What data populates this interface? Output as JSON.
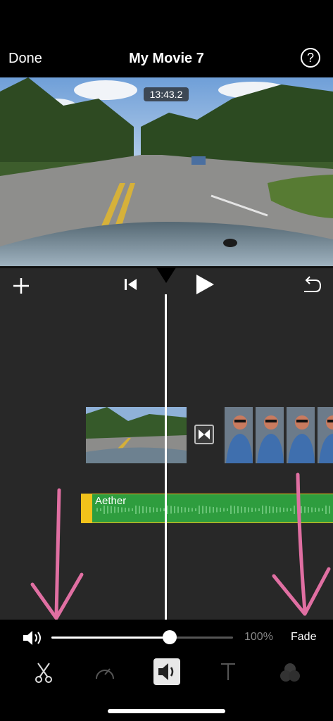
{
  "header": {
    "done_label": "Done",
    "title": "My Movie 7",
    "help_label": "?"
  },
  "preview": {
    "timestamp": "13:43.2"
  },
  "toolbar": {
    "add_icon": "plus-icon",
    "rewind_icon": "skip-back-icon",
    "play_icon": "play-icon",
    "undo_icon": "undo-icon"
  },
  "timeline": {
    "audio_clip_name": "Aether"
  },
  "volume": {
    "percent_label": "100%",
    "fade_label": "Fade",
    "level": 0.65
  },
  "tabs": [
    {
      "icon": "scissors-icon",
      "selected": false
    },
    {
      "icon": "speed-icon",
      "selected": false
    },
    {
      "icon": "volume-icon",
      "selected": true
    },
    {
      "icon": "text-icon",
      "selected": false
    },
    {
      "icon": "filters-icon",
      "selected": false
    }
  ],
  "colors": {
    "audio_clip": "#2e9d3e",
    "audio_border": "#f1c21b",
    "annotation_arrow": "#e06fa2"
  }
}
